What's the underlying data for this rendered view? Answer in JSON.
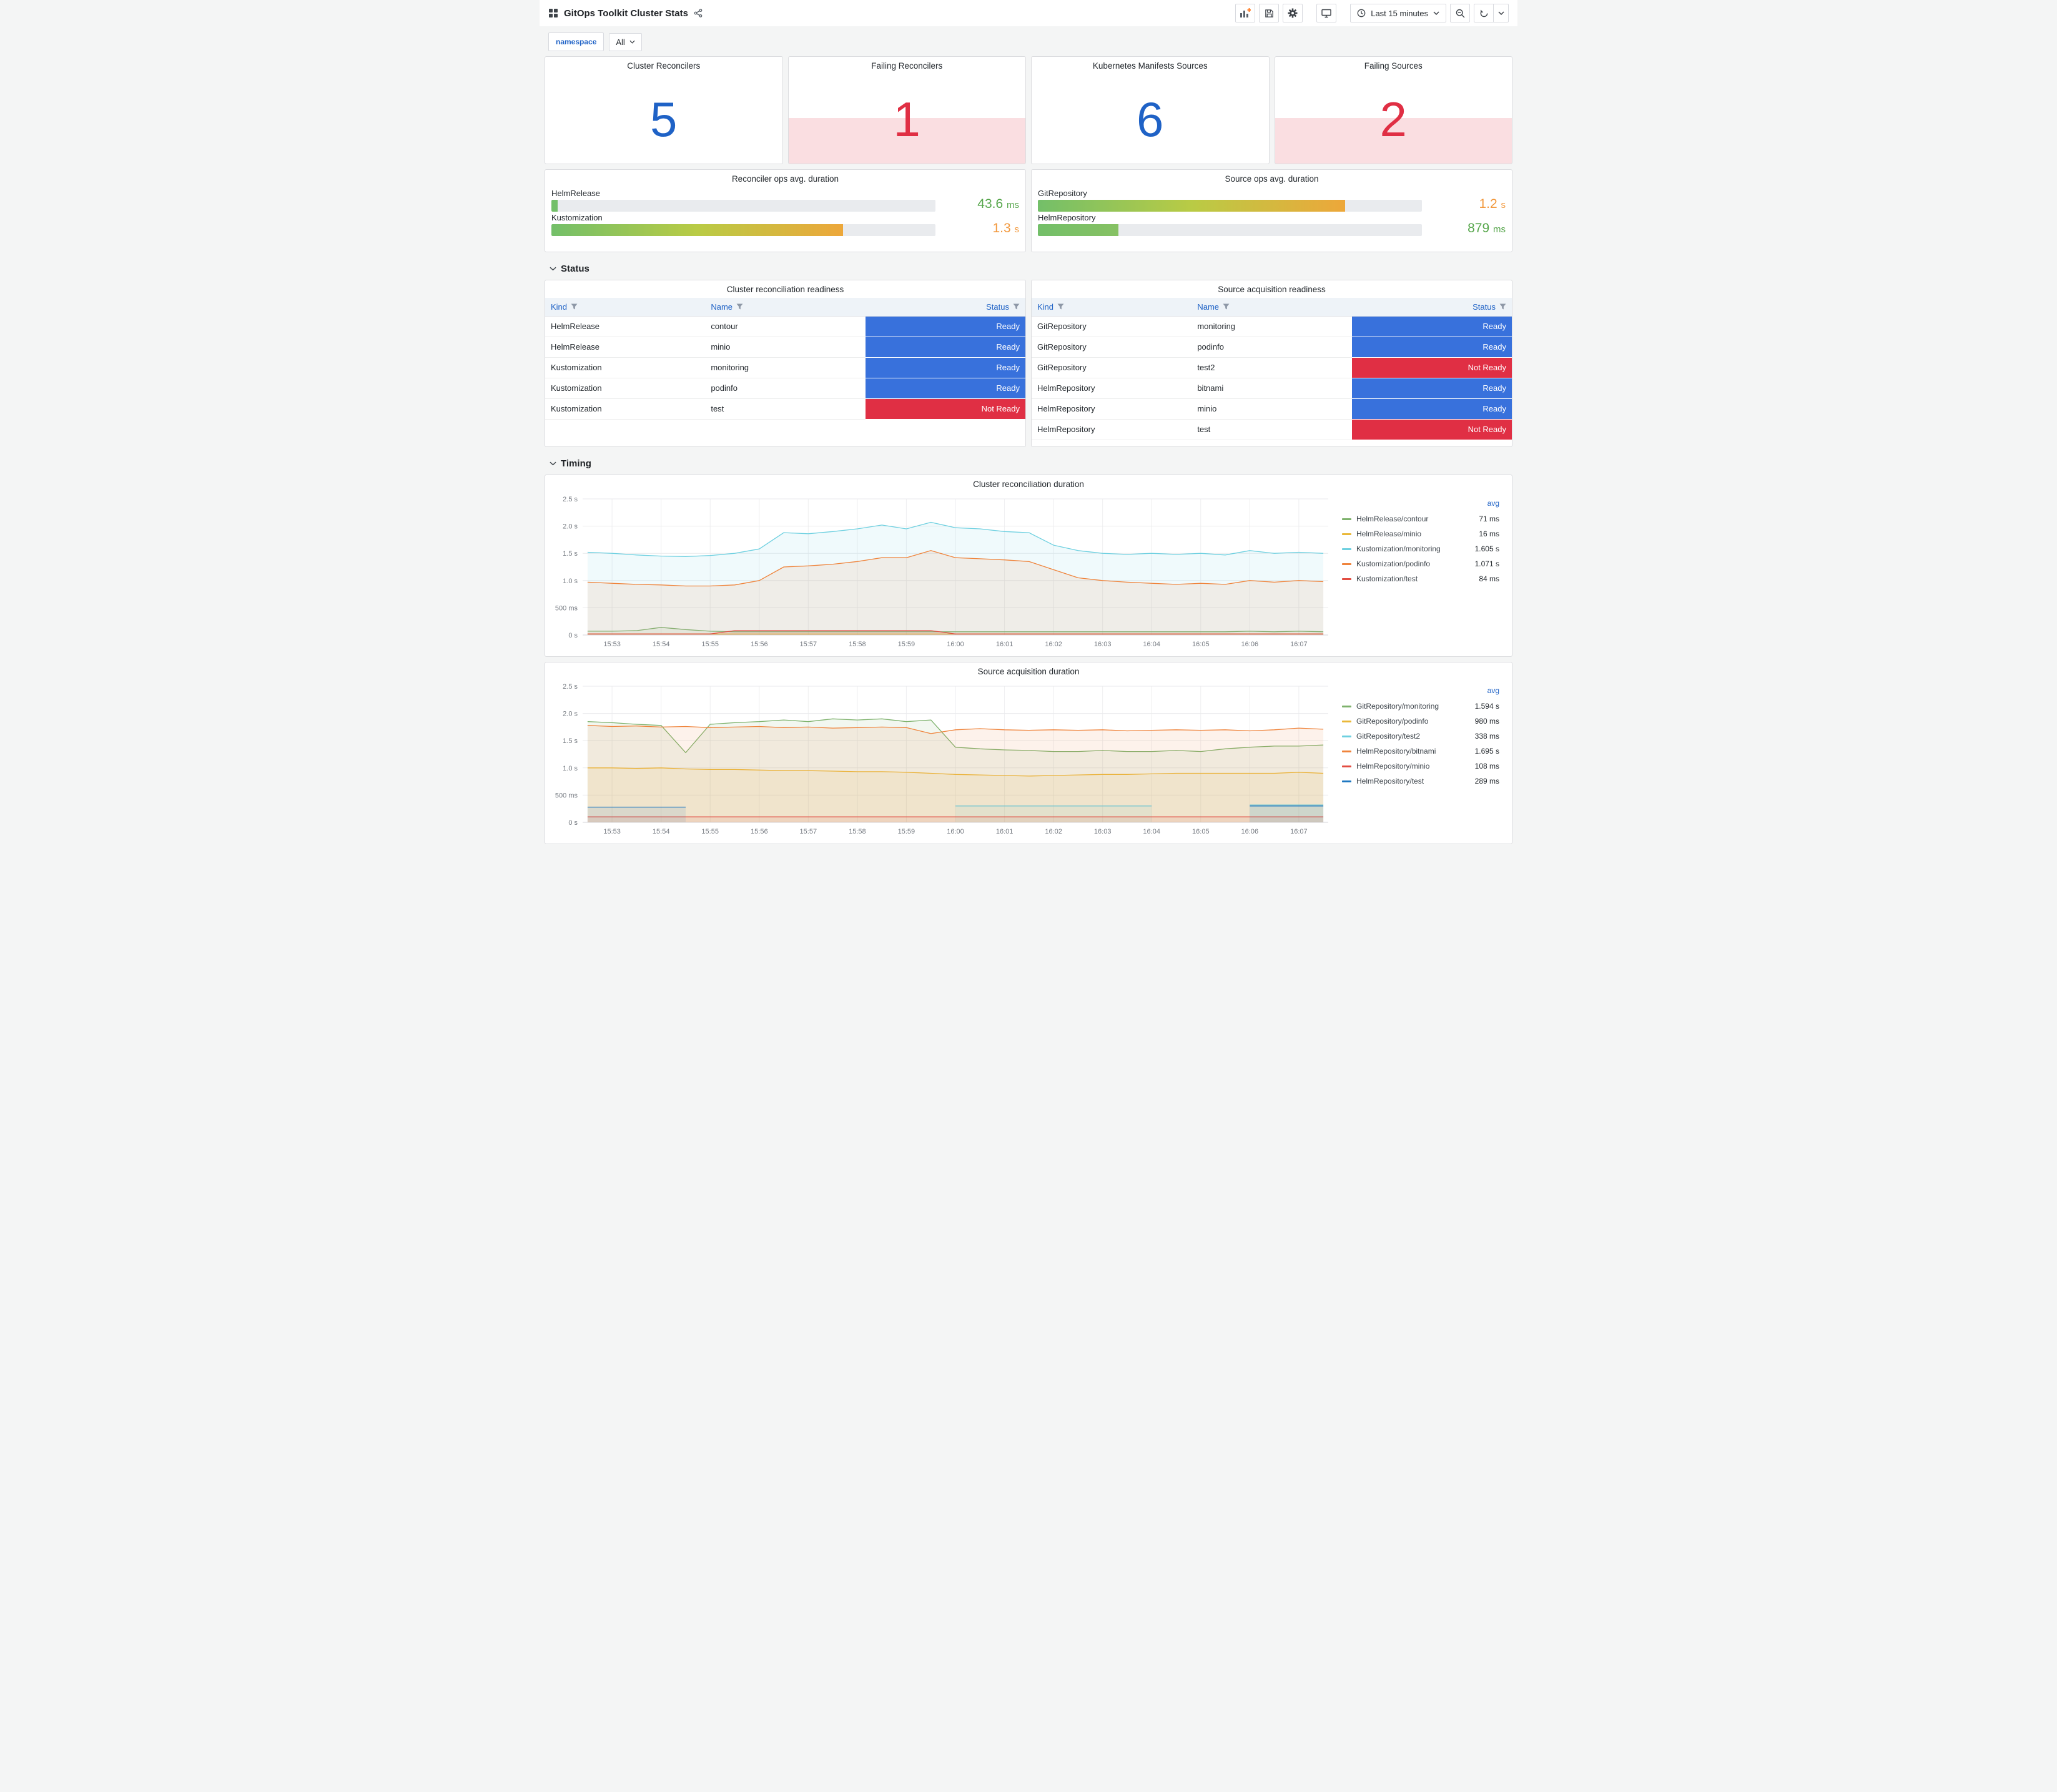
{
  "header": {
    "title": "GitOps Toolkit Cluster Stats",
    "time_picker": {
      "label": "Last 15 minutes"
    }
  },
  "icons": {
    "left": [
      "apps-grid-icon",
      "share-icon"
    ],
    "right": [
      "panel-add-icon",
      "save-icon",
      "gear-icon",
      "monitor-icon",
      "clock-icon",
      "caret-down-icon",
      "search-minus-icon",
      "sync-icon",
      "caret-down-icon"
    ],
    "table_header": "filter-funnel-icon",
    "section": "chevron-down-icon"
  },
  "colors": {
    "stat_ok": "#1f62c6",
    "stat_alert": "#e02f44",
    "alert_fill": "rgba(224,47,68,0.16)",
    "ready_bg": "#3871dc",
    "not_ready_bg": "#e02f44"
  },
  "variables": {
    "namespace_label": "namespace",
    "namespace_value": "All"
  },
  "stats": [
    {
      "title": "Cluster Reconcilers",
      "value": "5",
      "state": "ok",
      "value_color": "#1f62c6"
    },
    {
      "title": "Failing Reconcilers",
      "value": "1",
      "state": "alert",
      "value_color": "#e02f44"
    },
    {
      "title": "Kubernetes Manifests Sources",
      "value": "6",
      "state": "ok",
      "value_color": "#1f62c6"
    },
    {
      "title": "Failing Sources",
      "value": "2",
      "state": "alert",
      "value_color": "#e02f44"
    }
  ],
  "gauges": [
    {
      "title": "Reconciler ops avg. duration",
      "rows": [
        {
          "label": "HelmRelease",
          "value": "43.6",
          "unit": "ms",
          "pct": 1.6,
          "bar_colors": [
            "#73bf69"
          ],
          "value_color": "#56a64b"
        },
        {
          "label": "Kustomization",
          "value": "1.3",
          "unit": "s",
          "pct": 76,
          "bar_colors": [
            "#73bf69",
            "#b9cb45",
            "#eda73a"
          ],
          "value_color": "#f2993e"
        }
      ]
    },
    {
      "title": "Source ops avg. duration",
      "rows": [
        {
          "label": "GitRepository",
          "value": "1.2",
          "unit": "s",
          "pct": 80,
          "bar_colors": [
            "#73bf69",
            "#b9cb45",
            "#eda73a"
          ],
          "value_color": "#f2993e"
        },
        {
          "label": "HelmRepository",
          "value": "879",
          "unit": "ms",
          "pct": 21,
          "bar_colors": [
            "#73bf69",
            "#86c163"
          ],
          "value_color": "#56a64b"
        }
      ]
    }
  ],
  "sections": {
    "status": "Status",
    "timing": "Timing"
  },
  "tables": [
    {
      "title": "Cluster reconciliation readiness",
      "columns": [
        "Kind",
        "Name",
        "Status"
      ],
      "rows": [
        {
          "kind": "HelmRelease",
          "name": "contour",
          "status": "Ready"
        },
        {
          "kind": "HelmRelease",
          "name": "minio",
          "status": "Ready"
        },
        {
          "kind": "Kustomization",
          "name": "monitoring",
          "status": "Ready"
        },
        {
          "kind": "Kustomization",
          "name": "podinfo",
          "status": "Ready"
        },
        {
          "kind": "Kustomization",
          "name": "test",
          "status": "Not Ready"
        }
      ]
    },
    {
      "title": "Source acquisition readiness",
      "columns": [
        "Kind",
        "Name",
        "Status"
      ],
      "rows": [
        {
          "kind": "GitRepository",
          "name": "monitoring",
          "status": "Ready"
        },
        {
          "kind": "GitRepository",
          "name": "podinfo",
          "status": "Ready"
        },
        {
          "kind": "GitRepository",
          "name": "test2",
          "status": "Not Ready"
        },
        {
          "kind": "HelmRepository",
          "name": "bitnami",
          "status": "Ready"
        },
        {
          "kind": "HelmRepository",
          "name": "minio",
          "status": "Ready"
        },
        {
          "kind": "HelmRepository",
          "name": "test",
          "status": "Not Ready"
        }
      ]
    }
  ],
  "chart_data": [
    {
      "type": "line",
      "title": "Cluster reconciliation duration",
      "legend_header": "avg",
      "legend_position": "right",
      "grid": true,
      "x_domain": [
        0.4,
        15.6
      ],
      "y_domain": [
        0,
        2.5
      ],
      "x_tick_start": 1,
      "x_tick_labels": [
        "15:53",
        "15:54",
        "15:55",
        "15:56",
        "15:57",
        "15:58",
        "15:59",
        "16:00",
        "16:01",
        "16:02",
        "16:03",
        "16:04",
        "16:05",
        "16:06",
        "16:07"
      ],
      "y_ticks": [
        {
          "v": 0,
          "label": "0 s"
        },
        {
          "v": 0.5,
          "label": "500 ms"
        },
        {
          "v": 1,
          "label": "1.0 s"
        },
        {
          "v": 1.5,
          "label": "1.5 s"
        },
        {
          "v": 2,
          "label": "2.0 s"
        },
        {
          "v": 2.5,
          "label": "2.5 s"
        }
      ],
      "x": [
        0.5,
        1,
        1.5,
        2,
        2.5,
        3,
        3.5,
        4,
        4.5,
        5,
        5.5,
        6,
        6.5,
        7,
        7.5,
        8,
        8.5,
        9,
        9.5,
        10,
        10.5,
        11,
        11.5,
        12,
        12.5,
        13,
        13.5,
        14,
        14.5,
        15,
        15.5
      ],
      "series": [
        {
          "name": "HelmRelease/contour",
          "color": "#7EB26D",
          "avg": "71 ms",
          "values": [
            0.07,
            0.07,
            0.08,
            0.14,
            0.1,
            0.07,
            0.06,
            0.06,
            0.06,
            0.06,
            0.06,
            0.06,
            0.06,
            0.06,
            0.06,
            0.06,
            0.06,
            0.06,
            0.06,
            0.06,
            0.06,
            0.06,
            0.06,
            0.06,
            0.06,
            0.06,
            0.06,
            0.07,
            0.06,
            0.07,
            0.06
          ]
        },
        {
          "name": "HelmRelease/minio",
          "color": "#EAB839",
          "avg": "16 ms",
          "values": [
            0.02,
            0.02,
            0.02,
            0.02,
            0.02,
            0.02,
            0.02,
            0.02,
            0.02,
            0.02,
            0.02,
            0.02,
            0.02,
            0.02,
            0.02,
            0.02,
            0.02,
            0.02,
            0.02,
            0.02,
            0.02,
            0.02,
            0.02,
            0.02,
            0.02,
            0.02,
            0.02,
            0.02,
            0.02,
            0.02,
            0.02
          ]
        },
        {
          "name": "Kustomization/monitoring",
          "color": "#6ED0E0",
          "avg": "1.605 s",
          "values": [
            1.52,
            1.5,
            1.47,
            1.45,
            1.44,
            1.46,
            1.5,
            1.58,
            1.88,
            1.86,
            1.9,
            1.95,
            2.02,
            1.95,
            2.07,
            1.97,
            1.95,
            1.9,
            1.88,
            1.65,
            1.55,
            1.5,
            1.48,
            1.5,
            1.48,
            1.5,
            1.47,
            1.55,
            1.5,
            1.52,
            1.5
          ]
        },
        {
          "name": "Kustomization/podinfo",
          "color": "#EF843C",
          "avg": "1.071 s",
          "values": [
            0.97,
            0.95,
            0.93,
            0.92,
            0.9,
            0.9,
            0.92,
            1.0,
            1.25,
            1.27,
            1.3,
            1.35,
            1.42,
            1.42,
            1.55,
            1.42,
            1.4,
            1.38,
            1.35,
            1.2,
            1.05,
            1.0,
            0.97,
            0.95,
            0.93,
            0.95,
            0.93,
            1.0,
            0.97,
            1.0,
            0.98
          ]
        },
        {
          "name": "Kustomization/test",
          "color": "#E24D42",
          "avg": "84 ms",
          "values": [
            0.02,
            0.02,
            0.02,
            0.02,
            0.02,
            0.02,
            0.08,
            0.08,
            0.08,
            0.08,
            0.08,
            0.08,
            0.08,
            0.08,
            0.08,
            0.02,
            0.02,
            0.02,
            0.02,
            0.02,
            0.02,
            0.02,
            0.02,
            0.02,
            0.02,
            0.02,
            0.02,
            0.02,
            0.02,
            0.02,
            0.02
          ]
        }
      ]
    },
    {
      "type": "line",
      "title": "Source acquisition duration",
      "legend_header": "avg",
      "legend_position": "right",
      "grid": true,
      "x_domain": [
        0.4,
        15.6
      ],
      "y_domain": [
        0,
        2.5
      ],
      "x_tick_start": 1,
      "x_tick_labels": [
        "15:53",
        "15:54",
        "15:55",
        "15:56",
        "15:57",
        "15:58",
        "15:59",
        "16:00",
        "16:01",
        "16:02",
        "16:03",
        "16:04",
        "16:05",
        "16:06",
        "16:07"
      ],
      "y_ticks": [
        {
          "v": 0,
          "label": "0 s"
        },
        {
          "v": 0.5,
          "label": "500 ms"
        },
        {
          "v": 1,
          "label": "1.0 s"
        },
        {
          "v": 1.5,
          "label": "1.5 s"
        },
        {
          "v": 2,
          "label": "2.0 s"
        },
        {
          "v": 2.5,
          "label": "2.5 s"
        }
      ],
      "x": [
        0.5,
        1,
        1.5,
        2,
        2.5,
        3,
        3.5,
        4,
        4.5,
        5,
        5.5,
        6,
        6.5,
        7,
        7.5,
        8,
        8.5,
        9,
        9.5,
        10,
        10.5,
        11,
        11.5,
        12,
        12.5,
        13,
        13.5,
        14,
        14.5,
        15,
        15.5
      ],
      "series": [
        {
          "name": "GitRepository/monitoring",
          "color": "#7EB26D",
          "avg": "1.594 s",
          "values": [
            1.85,
            1.83,
            1.8,
            1.78,
            1.28,
            1.8,
            1.83,
            1.85,
            1.88,
            1.85,
            1.9,
            1.88,
            1.9,
            1.85,
            1.88,
            1.38,
            1.35,
            1.33,
            1.32,
            1.3,
            1.3,
            1.32,
            1.3,
            1.3,
            1.32,
            1.3,
            1.35,
            1.38,
            1.4,
            1.4,
            1.42
          ]
        },
        {
          "name": "GitRepository/podinfo",
          "color": "#EAB839",
          "avg": "980 ms",
          "values": [
            1.0,
            1.0,
            0.99,
            1.0,
            0.98,
            0.97,
            0.97,
            0.96,
            0.95,
            0.95,
            0.94,
            0.93,
            0.93,
            0.92,
            0.9,
            0.88,
            0.87,
            0.86,
            0.85,
            0.86,
            0.87,
            0.88,
            0.88,
            0.89,
            0.9,
            0.9,
            0.9,
            0.9,
            0.9,
            0.92,
            0.9
          ]
        },
        {
          "name": "GitRepository/test2",
          "color": "#6ED0E0",
          "avg": "338 ms",
          "values": [
            null,
            null,
            null,
            null,
            null,
            null,
            null,
            null,
            null,
            null,
            null,
            null,
            null,
            null,
            null,
            0.3,
            0.3,
            0.3,
            0.3,
            0.3,
            0.3,
            0.3,
            0.3,
            0.3,
            null,
            null,
            null,
            0.32,
            0.32,
            0.32,
            0.32
          ]
        },
        {
          "name": "HelmRepository/bitnami",
          "color": "#EF843C",
          "avg": "1.695 s",
          "values": [
            1.78,
            1.76,
            1.77,
            1.75,
            1.76,
            1.74,
            1.75,
            1.76,
            1.74,
            1.75,
            1.73,
            1.74,
            1.75,
            1.74,
            1.63,
            1.7,
            1.72,
            1.7,
            1.69,
            1.7,
            1.69,
            1.7,
            1.68,
            1.69,
            1.7,
            1.69,
            1.7,
            1.68,
            1.7,
            1.73,
            1.71
          ]
        },
        {
          "name": "HelmRepository/minio",
          "color": "#E24D42",
          "avg": "108 ms",
          "values": [
            0.1,
            0.1,
            0.1,
            0.1,
            0.1,
            0.1,
            0.1,
            0.1,
            0.1,
            0.1,
            0.1,
            0.1,
            0.1,
            0.1,
            0.1,
            0.1,
            0.1,
            0.1,
            0.1,
            0.1,
            0.1,
            0.1,
            0.1,
            0.1,
            0.1,
            0.1,
            0.1,
            0.1,
            0.1,
            0.1,
            0.1
          ]
        },
        {
          "name": "HelmRepository/test",
          "color": "#1F78C1",
          "avg": "289 ms",
          "values": [
            0.28,
            0.28,
            0.28,
            0.28,
            0.28,
            null,
            null,
            null,
            null,
            null,
            null,
            null,
            null,
            null,
            null,
            null,
            null,
            null,
            null,
            null,
            null,
            null,
            null,
            null,
            null,
            null,
            null,
            0.3,
            0.3,
            0.3,
            0.3
          ]
        }
      ]
    }
  ]
}
